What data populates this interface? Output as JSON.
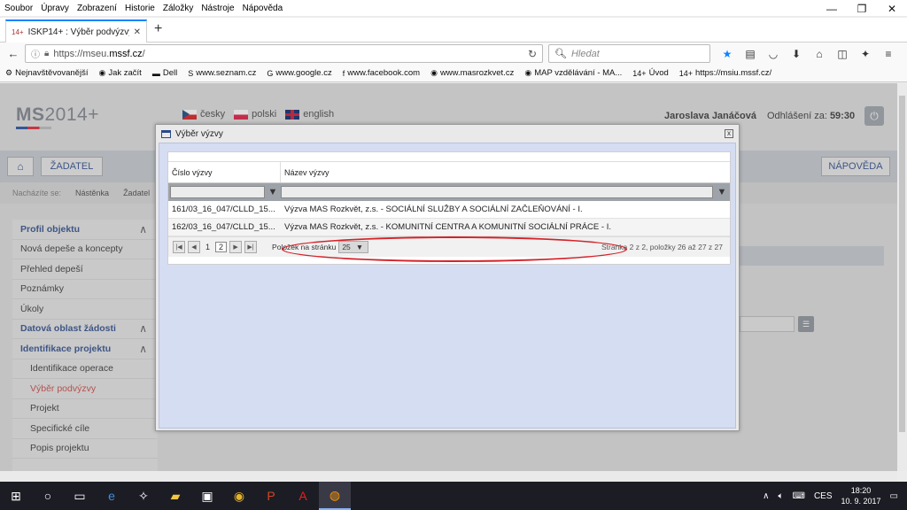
{
  "menubar": [
    "Soubor",
    "Úpravy",
    "Zobrazení",
    "Historie",
    "Záložky",
    "Nástroje",
    "Nápověda"
  ],
  "window_controls": {
    "minimize": "—",
    "restore": "❐",
    "close": "✕"
  },
  "tab": {
    "title": "ISKP14+ : Výběr podvýzvy",
    "favicon": "14+"
  },
  "nav": {
    "url_prefix": "https://mseu.",
    "url_domain": "mssf.cz",
    "search_placeholder": "Hledat",
    "toolbar_icons": [
      "star-icon",
      "reading-list-icon",
      "pocket-icon",
      "download-icon",
      "home-icon",
      "screenshot-icon",
      "extension-icon",
      "menu-icon"
    ]
  },
  "bookmarks": [
    {
      "label": "Nejnavštěvovanější",
      "icon": "⚙"
    },
    {
      "label": "Jak začít",
      "icon": "◉"
    },
    {
      "label": "Dell",
      "icon": "▬"
    },
    {
      "label": "www.seznam.cz",
      "icon": "S"
    },
    {
      "label": "www.google.cz",
      "icon": "G"
    },
    {
      "label": "www.facebook.com",
      "icon": "f"
    },
    {
      "label": "www.masrozkvet.cz",
      "icon": "◉"
    },
    {
      "label": "MAP vzdělávání - MA...",
      "icon": "◉"
    },
    {
      "label": "Úvod",
      "icon": "14+"
    },
    {
      "label": "https://msiu.mssf.cz/",
      "icon": "14+"
    }
  ],
  "header": {
    "logo_bold": "MS",
    "logo_rest": "2014+",
    "languages": [
      "česky",
      "polski",
      "english"
    ],
    "user": "Jaroslava Janáčová",
    "logout_label": "Odhlášení za:",
    "logout_time": "59:30"
  },
  "topnav": {
    "home_icon": "⌂",
    "zadatel": "ŽADATEL",
    "napoveda": "NÁPOVĚDA"
  },
  "breadcrumb": [
    "Nacházíte se:",
    "Nástěnka",
    "Žadatel"
  ],
  "sidebar": [
    {
      "label": "Profil objektu",
      "type": "header"
    },
    {
      "label": "Nová depeše a koncepty",
      "type": "item"
    },
    {
      "label": "Přehled depeší",
      "type": "item"
    },
    {
      "label": "Poznámky",
      "type": "item"
    },
    {
      "label": "Úkoly",
      "type": "item"
    },
    {
      "label": "Datová oblast žádosti",
      "type": "header"
    },
    {
      "label": "Identifikace projektu",
      "type": "header"
    },
    {
      "label": "Identifikace operace",
      "type": "sub"
    },
    {
      "label": "Výběr podvýzvy",
      "type": "sub-active"
    },
    {
      "label": "Projekt",
      "type": "sub"
    },
    {
      "label": "Specifické cíle",
      "type": "sub"
    },
    {
      "label": "Popis projektu",
      "type": "sub"
    }
  ],
  "dialog": {
    "title": "Výběr výzvy",
    "close": "x",
    "columns": [
      "Číslo výzvy",
      "Název výzvy"
    ],
    "rows": [
      {
        "cislo": "161/03_16_047/CLLD_15...",
        "nazev": "Výzva MAS Rozkvět, z.s. - SOCIÁLNÍ SLUŽBY A SOCIÁLNÍ ZAČLEŇOVÁNÍ - I."
      },
      {
        "cislo": "162/03_16_047/CLLD_15...",
        "nazev": "Výzva MAS Rozkvět, z.s. - KOMUNITNÍ CENTRA A KOMUNITNÍ SOCIÁLNÍ PRÁCE - I."
      }
    ],
    "pager": {
      "pages": [
        "1",
        "2"
      ],
      "current_page": "2",
      "per_page_label": "Položek na stránku",
      "per_page_value": "25",
      "status": "Stránka 2 z 2, položky 26 až 27 z 27"
    }
  },
  "taskbar": {
    "icons": [
      "windows-start-icon",
      "search-icon",
      "task-view-icon",
      "edge-icon",
      "app-icon",
      "file-explorer-icon",
      "store-icon",
      "chrome-icon",
      "powerpoint-icon",
      "acrobat-icon",
      "firefox-icon"
    ],
    "language": "CES",
    "time": "18:20",
    "date": "10. 9. 2017"
  }
}
